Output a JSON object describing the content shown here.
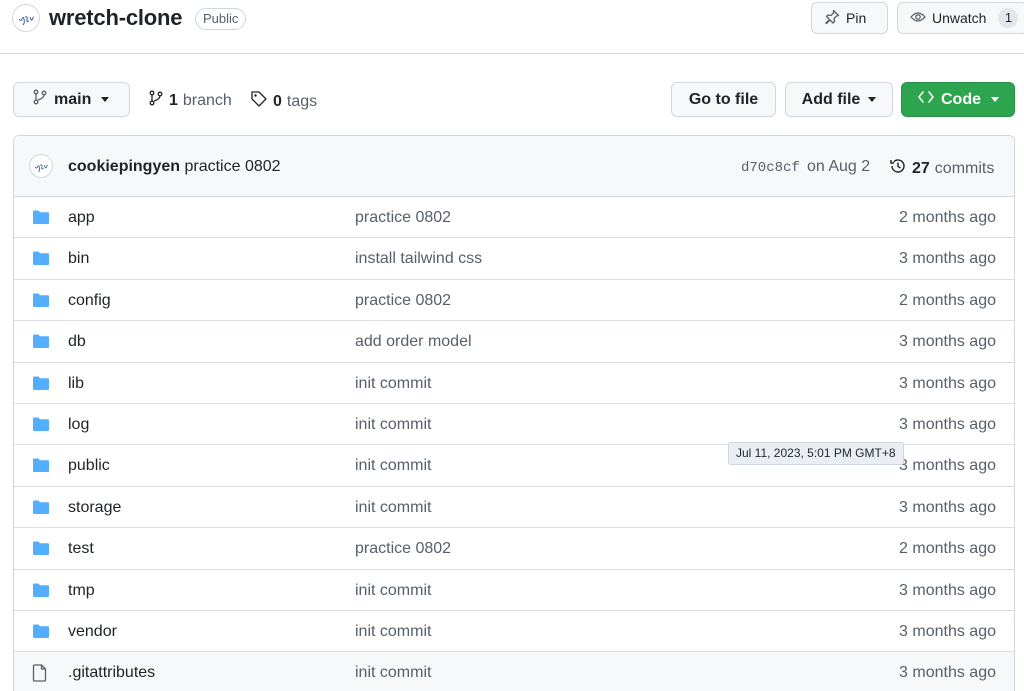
{
  "repo": {
    "name": "wretch-clone",
    "visibility": "Public"
  },
  "header_actions": {
    "pin_label": "Pin",
    "unwatch_label": "Unwatch",
    "watch_count": "1"
  },
  "toolbar": {
    "branch_label": "main",
    "branches_count": "1",
    "branches_label": "branch",
    "tags_count": "0",
    "tags_label": "tags",
    "go_to_file_label": "Go to file",
    "add_file_label": "Add file",
    "code_label": "Code"
  },
  "latest_commit": {
    "author": "cookiepingyen",
    "message": "practice 0802",
    "sha": "d70c8cf",
    "date": "on Aug 2",
    "commits_count": "27",
    "commits_label": "commits"
  },
  "files": [
    {
      "name": "app",
      "type": "folder",
      "message": "practice 0802",
      "age": "2 months ago"
    },
    {
      "name": "bin",
      "type": "folder",
      "message": "install tailwind css",
      "age": "3 months ago"
    },
    {
      "name": "config",
      "type": "folder",
      "message": "practice 0802",
      "age": "2 months ago"
    },
    {
      "name": "db",
      "type": "folder",
      "message": "add order model",
      "age": "3 months ago"
    },
    {
      "name": "lib",
      "type": "folder",
      "message": "init commit",
      "age": "3 months ago"
    },
    {
      "name": "log",
      "type": "folder",
      "message": "init commit",
      "age": "3 months ago"
    },
    {
      "name": "public",
      "type": "folder",
      "message": "init commit",
      "age": "3 months ago"
    },
    {
      "name": "storage",
      "type": "folder",
      "message": "init commit",
      "age": "3 months ago"
    },
    {
      "name": "test",
      "type": "folder",
      "message": "practice 0802",
      "age": "2 months ago"
    },
    {
      "name": "tmp",
      "type": "folder",
      "message": "init commit",
      "age": "3 months ago"
    },
    {
      "name": "vendor",
      "type": "folder",
      "message": "init commit",
      "age": "3 months ago"
    },
    {
      "name": ".gitattributes",
      "type": "file",
      "message": "init commit",
      "age": "3 months ago"
    }
  ],
  "tooltip": {
    "text": "Jul 11, 2023, 5:01 PM GMT+8"
  },
  "colors": {
    "folder": "#54aeff",
    "code_button": "#2da44e",
    "border": "#d0d7de",
    "muted_text": "#57606a"
  },
  "icons": {
    "folder": "folder-icon",
    "file": "file-icon",
    "branch": "git-branch-icon",
    "tag": "tag-icon",
    "history": "history-icon",
    "pin": "pin-icon",
    "eye": "eye-icon",
    "code": "code-icon"
  }
}
